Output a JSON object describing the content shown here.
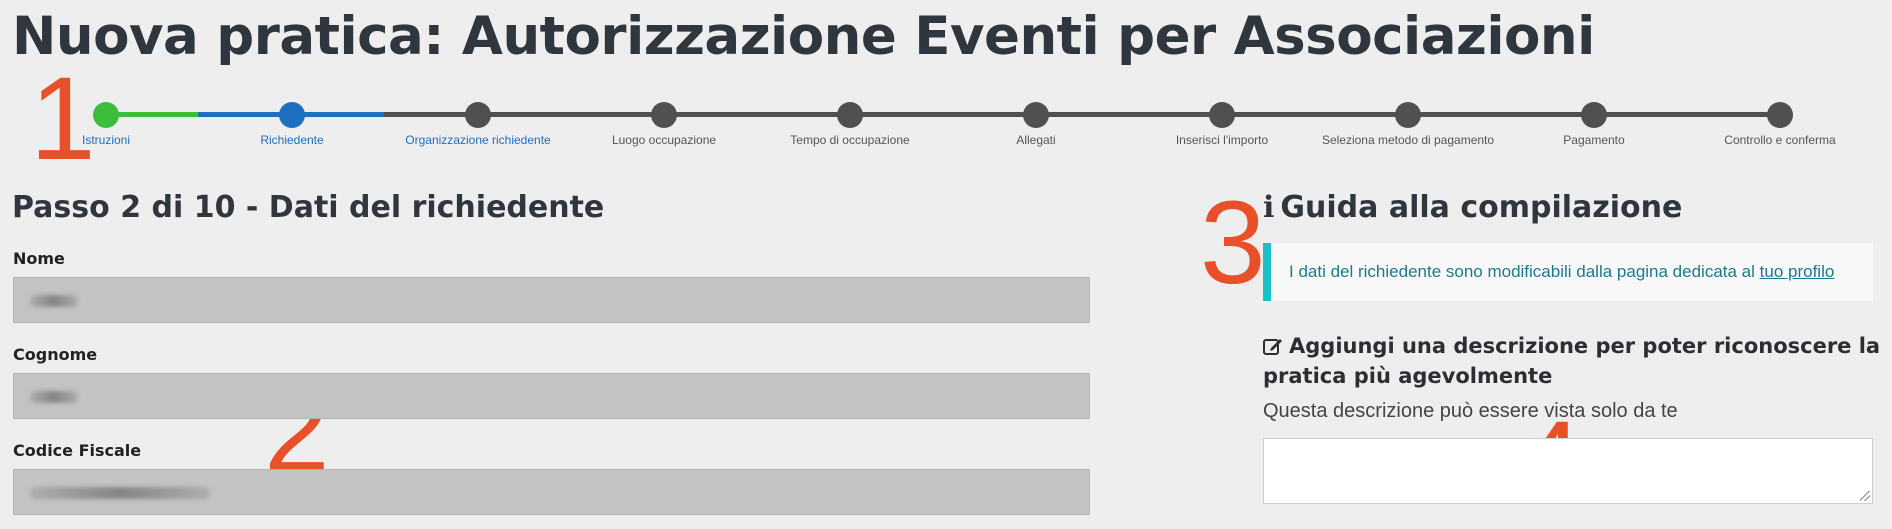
{
  "page": {
    "title": "Nuova pratica: Autorizzazione Eventi per Associazioni"
  },
  "stepper": {
    "steps": [
      {
        "label": "Istruzioni",
        "state": "done"
      },
      {
        "label": "Richiedente",
        "state": "current"
      },
      {
        "label": "Organizzazione richiedente",
        "state": "pending-highlight"
      },
      {
        "label": "Luogo occupazione",
        "state": "pending"
      },
      {
        "label": "Tempo di occupazione",
        "state": "pending"
      },
      {
        "label": "Allegati",
        "state": "pending"
      },
      {
        "label": "Inserisci l'importo",
        "state": "pending"
      },
      {
        "label": "Seleziona metodo di pagamento",
        "state": "pending"
      },
      {
        "label": "Pagamento",
        "state": "pending"
      },
      {
        "label": "Controllo e conferma",
        "state": "pending"
      }
    ],
    "colors": {
      "done": "#3bbf3b",
      "current": "#1e6fc0",
      "pending": "#505050"
    }
  },
  "annotations": [
    "1",
    "2",
    "3",
    "4"
  ],
  "form": {
    "section_title": "Passo 2 di 10 - Dati del richiedente",
    "fields": [
      {
        "label": "Nome",
        "value": ""
      },
      {
        "label": "Cognome",
        "value": ""
      },
      {
        "label": "Codice Fiscale",
        "value": ""
      }
    ]
  },
  "guide": {
    "title": "Guida alla compilazione",
    "info_icon": "info-icon",
    "callout_text": "I dati del richiedente sono modificabili dalla pagina dedicata al",
    "callout_link": "tuo profilo",
    "accent": "#1bbfc8"
  },
  "description": {
    "title": "Aggiungi una descrizione per poter riconoscere la pratica più agevolmente",
    "hint": "Questa descrizione può essere vista solo da te",
    "value": ""
  }
}
